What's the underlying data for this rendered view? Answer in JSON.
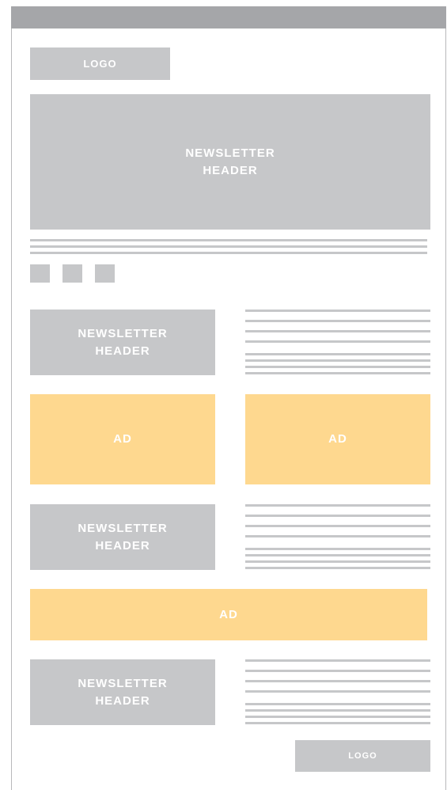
{
  "header": {
    "logo_label": "LOGO",
    "hero_label_line1": "NEWSLETTER",
    "hero_label_line2": "HEADER"
  },
  "social_icons": [
    "social-icon-1",
    "social-icon-2",
    "social-icon-3"
  ],
  "sections": [
    {
      "header_line1": "NEWSLETTER",
      "header_line2": "HEADER"
    },
    {
      "ad_left": "AD",
      "ad_right": "AD"
    },
    {
      "header_line1": "NEWSLETTER",
      "header_line2": "HEADER"
    },
    {
      "ad_full": "AD"
    },
    {
      "header_line1": "NEWSLETTER",
      "header_line2": "HEADER"
    }
  ],
  "footer": {
    "logo_label": "LOGO"
  },
  "colors": {
    "placeholder_gray": "#c6c7c9",
    "ad_yellow": "#fed88f",
    "top_bar": "#a5a6a9"
  }
}
